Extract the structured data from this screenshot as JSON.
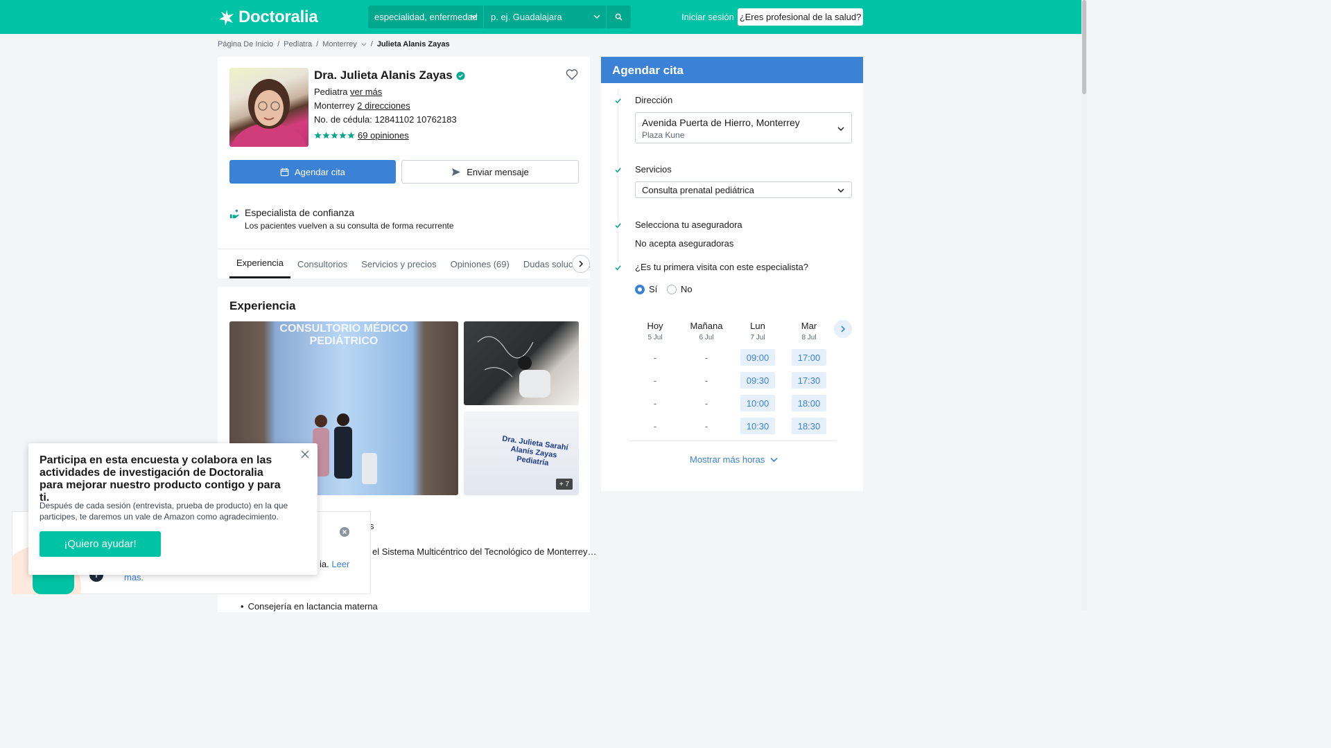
{
  "header": {
    "brand": "Doctoralia",
    "search_specialty_placeholder": "especialidad, enfermedad",
    "search_location_placeholder": "p. ej. Guadalajara",
    "login": "Iniciar sesión",
    "professional_cta": "¿Eres profesional de la salud?"
  },
  "breadcrumb": [
    "Página De Inicio",
    "Pediatra",
    "Monterrey",
    "Julieta Alanis Zayas"
  ],
  "doctor": {
    "name": "Dra. Julieta Alanis Zayas",
    "specialty": "Pediatra",
    "see_more": "ver más",
    "city": "Monterrey",
    "addresses_link": "2 direcciones",
    "license": "No. de cédula: 12841102 10762183",
    "rating_stars": 5,
    "reviews_link": "69 opiniones",
    "book_button": "Agendar cita",
    "message_button": "Enviar mensaje",
    "trust_title": "Especialista de confianza",
    "trust_subtitle": "Los pacientes vuelven a su consulta de forma recurrente"
  },
  "tabs": [
    "Experiencia",
    "Consultorios",
    "Servicios y precios",
    "Opiniones (69)",
    "Dudas solucionadas"
  ],
  "experience": {
    "title": "Experiencia",
    "photo_sign_1": "CONSULTORIO MÉDICO",
    "photo_sign_2": "PEDIÁTRICO",
    "embroidery_1": "Dra. Julieta Sarahí Alanís Zayas",
    "embroidery_2": "Pediatría",
    "more_photos": "+ 7",
    "snippet_s": "s",
    "snippet_line": "el Sistema Multicéntrico del Tecnológico de Monterrey…",
    "bullet": "Consejería en lactancia materna"
  },
  "survey": {
    "title": "Participa en esta encuesta y colabora en las actividades de investigación de Doctoralia para mejorar nuestro producto contigo y para ti.",
    "body": "Después de cada sesión (entrevista, prueba de producto) en la que participes, te daremos un vale de Amazon como agradecimiento.",
    "cta": "¡Quiero ayudar!"
  },
  "under_widget": {
    "text_fragment": "ia.",
    "link": "Leer más."
  },
  "booking": {
    "title": "Agendar cita",
    "address_label": "Dirección",
    "address_main": "Avenida Puerta de Hierro, Monterrey",
    "address_sub": "Plaza Kune",
    "services_label": "Servicios",
    "service_selected": "Consulta prenatal pediátrica",
    "insurance_label": "Selecciona tu aseguradora",
    "insurance_value": "No acepta aseguradoras",
    "first_visit_label": "¿Es tu primera visita con este especialista?",
    "yes": "Sí",
    "no": "No",
    "first_visit_selected": "Sí",
    "days": [
      {
        "name": "Hoy",
        "date": "5 Jul",
        "slots": [
          "-",
          "-",
          "-",
          "-"
        ]
      },
      {
        "name": "Mañana",
        "date": "6 Jul",
        "slots": [
          "-",
          "-",
          "-",
          "-"
        ]
      },
      {
        "name": "Lun",
        "date": "7 Jul",
        "slots": [
          "09:00",
          "09:30",
          "10:00",
          "10:30"
        ]
      },
      {
        "name": "Mar",
        "date": "8 Jul",
        "slots": [
          "17:00",
          "17:30",
          "18:00",
          "18:30"
        ]
      }
    ],
    "more_hours": "Mostrar más horas"
  },
  "colors": {
    "brand_teal": "#00c3a5",
    "primary_blue": "#3b82d6",
    "rating_green": "#00a88e"
  }
}
